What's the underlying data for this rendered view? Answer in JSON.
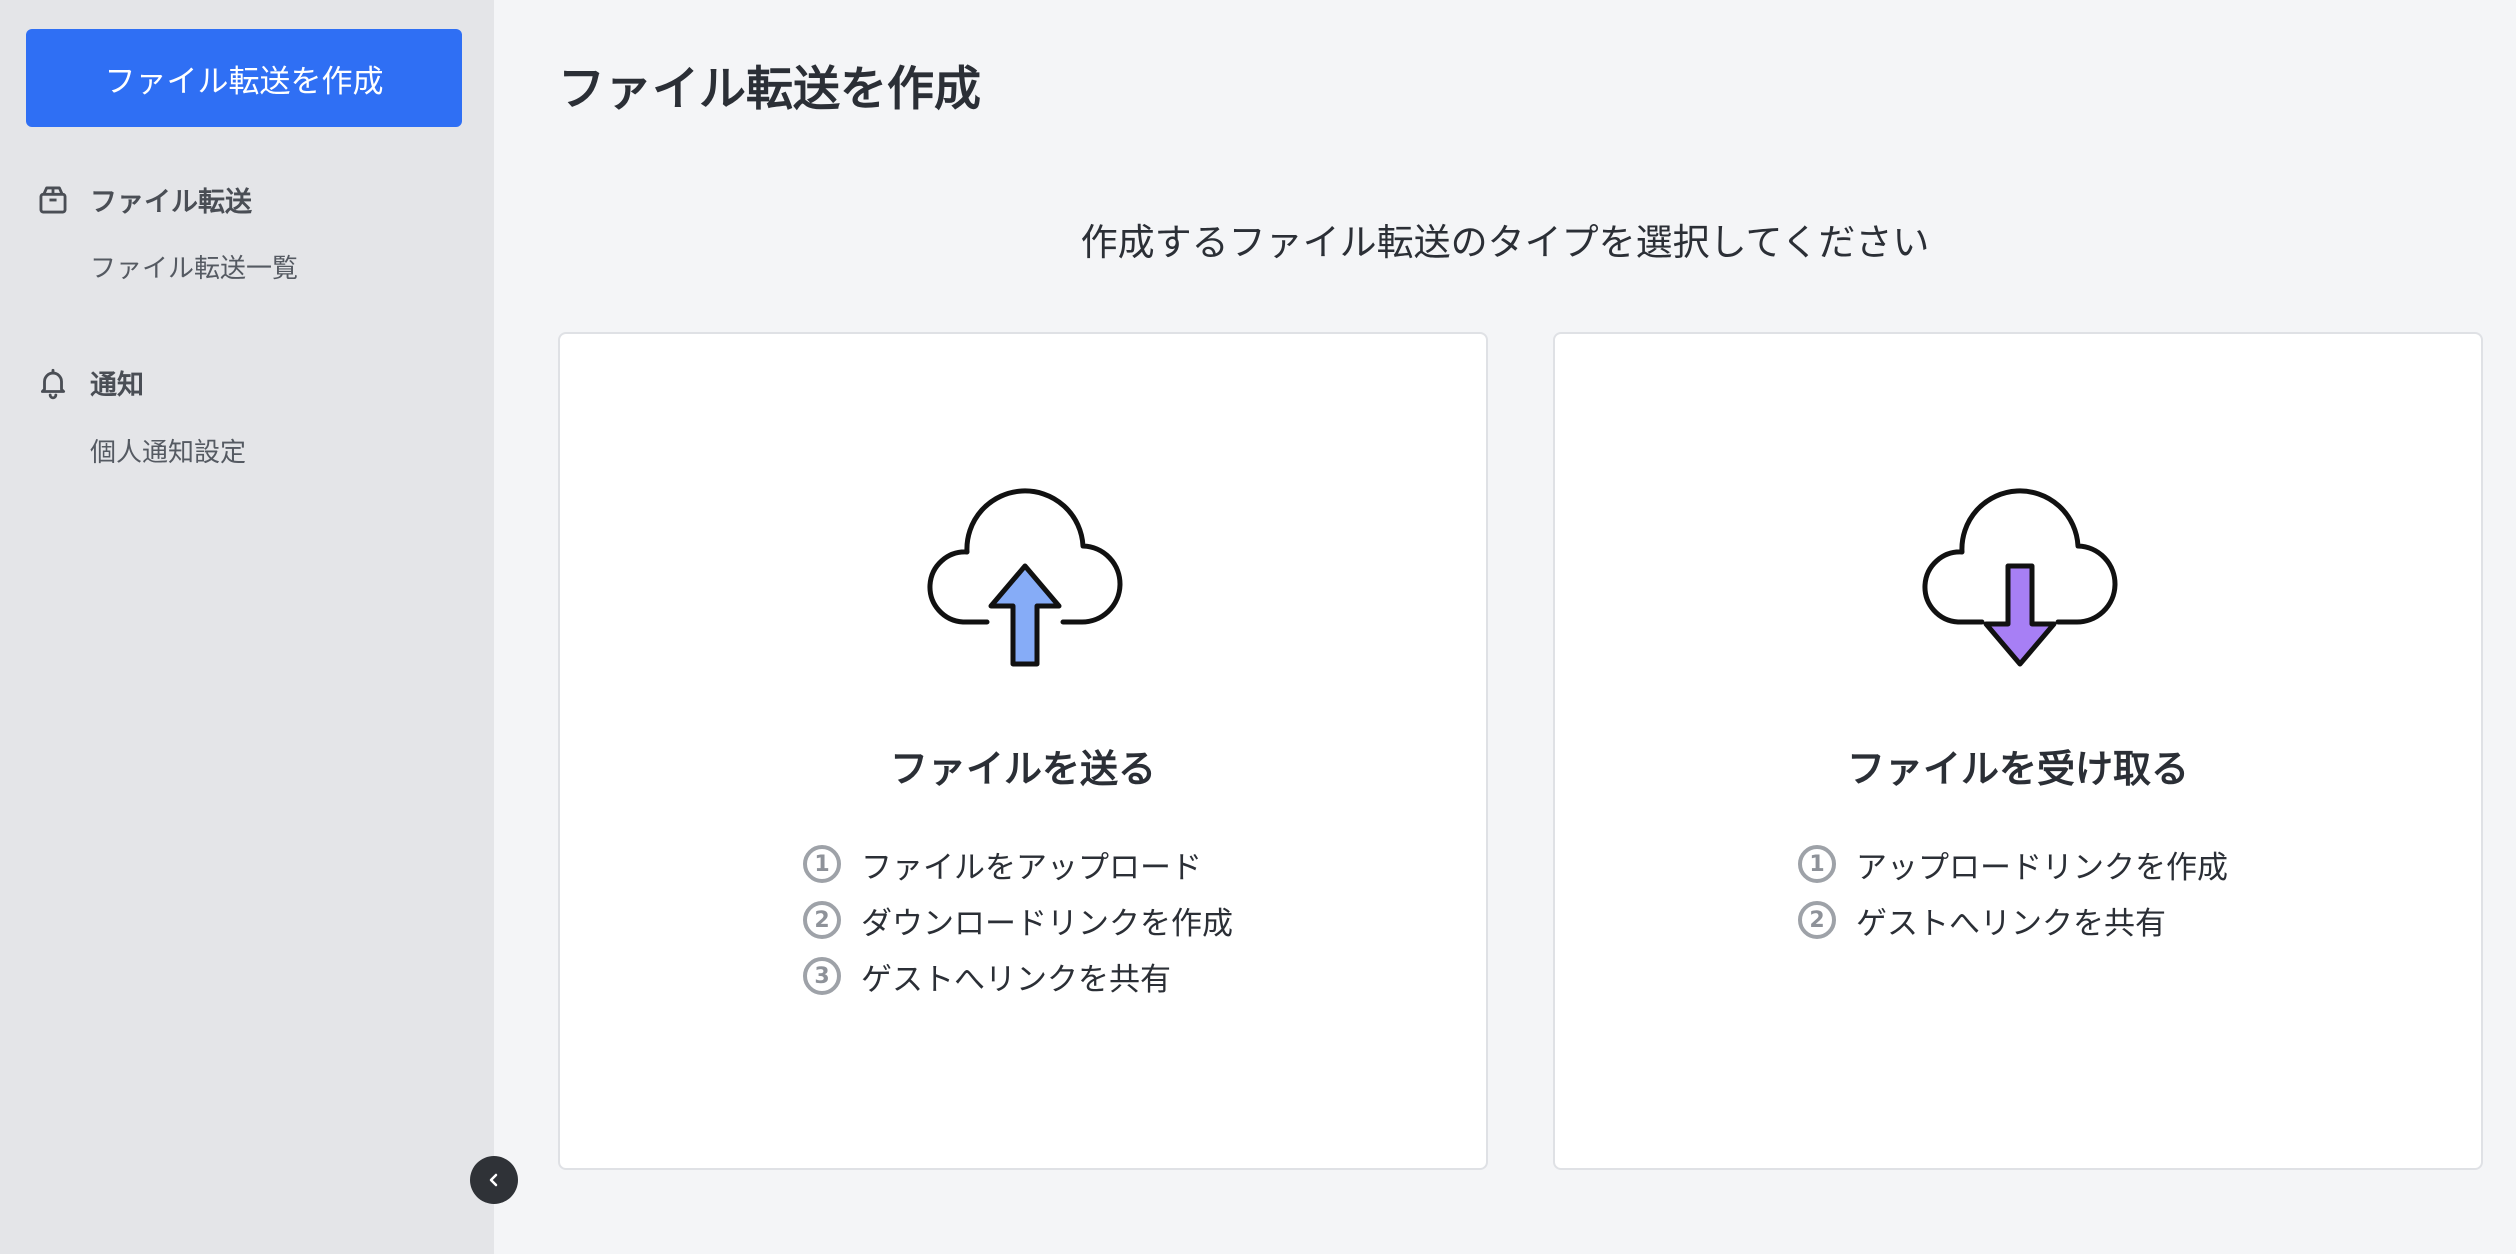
{
  "sidebar": {
    "create_button": "ファイル転送を作成",
    "sections": [
      {
        "label": "ファイル転送",
        "icon": "package-icon",
        "items": [
          "ファイル転送一覧"
        ]
      },
      {
        "label": "通知",
        "icon": "bell-icon",
        "items": [
          "個人通知設定"
        ]
      }
    ],
    "collapse_icon": "chevron-left-icon"
  },
  "main": {
    "title": "ファイル転送を作成",
    "prompt": "作成するファイル転送のタイプを選択してください",
    "cards": [
      {
        "title": "ファイルを送る",
        "icon": "cloud-upload-icon",
        "arrow_color": "#86acf7",
        "steps": [
          {
            "num": "1",
            "text": "ファイルをアップロード"
          },
          {
            "num": "2",
            "text": "ダウンロードリンクを作成"
          },
          {
            "num": "3",
            "text": "ゲストへリンクを共有"
          }
        ]
      },
      {
        "title": "ファイルを受け取る",
        "icon": "cloud-download-icon",
        "arrow_color": "#a77ff5",
        "steps": [
          {
            "num": "1",
            "text": "アップロードリンクを作成"
          },
          {
            "num": "2",
            "text": "ゲストへリンクを共有"
          }
        ]
      }
    ]
  },
  "colors": {
    "accent": "#2f6ff4",
    "sidebar_bg": "#e4e5e8",
    "main_bg": "#f4f5f7"
  }
}
